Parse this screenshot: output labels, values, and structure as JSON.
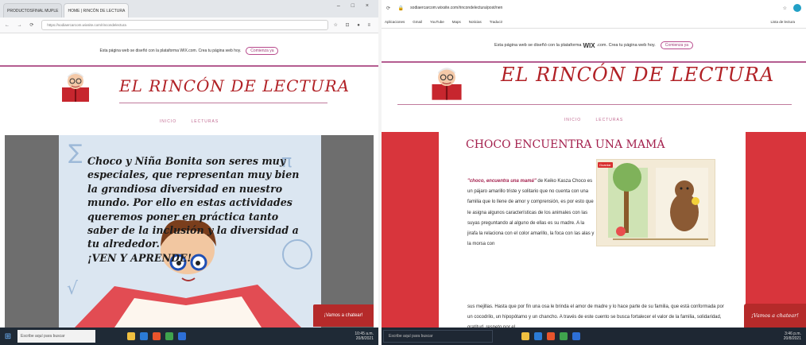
{
  "left_browser": {
    "tabs": [
      {
        "label": "PRODUCTOSFINAL MUPLE"
      },
      {
        "label": "HOME | RINCÓN DE LECTURA"
      }
    ],
    "window_controls": "–  □  ×",
    "url": "https://sodiaercarcom.wixsite.com/rincondelectura",
    "wix_banner": {
      "text": "Esta página web se diseñó con la plataforma WIX.com. Crea tu página web hoy.",
      "button": "Comienza ya"
    },
    "site_title": "EL RINCÓN DE LECTURA",
    "menu": [
      "INICIO",
      "LECTURAS"
    ],
    "story_text": "Choco y Niña Bonita son seres muy especiales, que representan muy bien la grandiosa diversidad en nuestro mundo. Por ello en estas actividades queremos poner en práctica tanto saber de la inclusión y la diversidad a tu alrededor.",
    "story_tail": "¡VEN Y APRENDE!",
    "chat_button": "¡Vamos a chatear!",
    "taskbar": {
      "search": "Escribe aquí para buscar",
      "time": "10:45 a.m.",
      "date": "20/8/2021"
    }
  },
  "right_browser": {
    "url": "sodiaercarcom.wixsite.com/rincondelectura/post/nen",
    "bookmarks": [
      "Aplicaciones",
      "Gmail",
      "YouTube",
      "Maps",
      "Noticias",
      "Traducir",
      "Lista de lectura"
    ],
    "wix_banner": {
      "pre": "Esta página web se diseñó con la plataforma",
      "brand": "WIX",
      "post": ".com. Crea tu página web hoy.",
      "button": "Comienza ya"
    },
    "site_title": "EL RINCÓN DE LECTURA",
    "menu": [
      "INICIO",
      "LECTURAS"
    ],
    "post_title": "CHOCO ENCUENTRA UNA MAMÁ",
    "post_lead": "\"choco, encuentra una mamá\"",
    "post_body": " de Keiko Kasza Choco es un pájaro amarillo triste y solitario que no cuenta con una familia que lo llene de amor y comprensión, es por esto que le asigna algunos características de los animales con las suyas preguntando al alguno de ellas es su madre. A la jirafa la relaciona con el color amarillo, la foca con las alas y la morsa con",
    "post_body_wide": "sus mejillas. Hasta que por fin una osa le brinda el amor de madre y lo hace parte de su familia, que está conformada por un cocodrilo, un hipopótamo y un chancho. A través de este cuento se busca fortalecer el valor de la familia, solidaridad, gratitud, respeto por el",
    "image_badge": "Guardar",
    "chat_button": "¡Vamos a chatear!",
    "taskbar": {
      "search": "Escribe aquí para buscar",
      "time": "3:46 p.m.",
      "date": "20/8/2021"
    }
  },
  "colors": {
    "brand_red": "#b12126",
    "accent_pink": "#b45d91",
    "band_red": "#d8353c",
    "chat_red": "#b52a2a"
  }
}
